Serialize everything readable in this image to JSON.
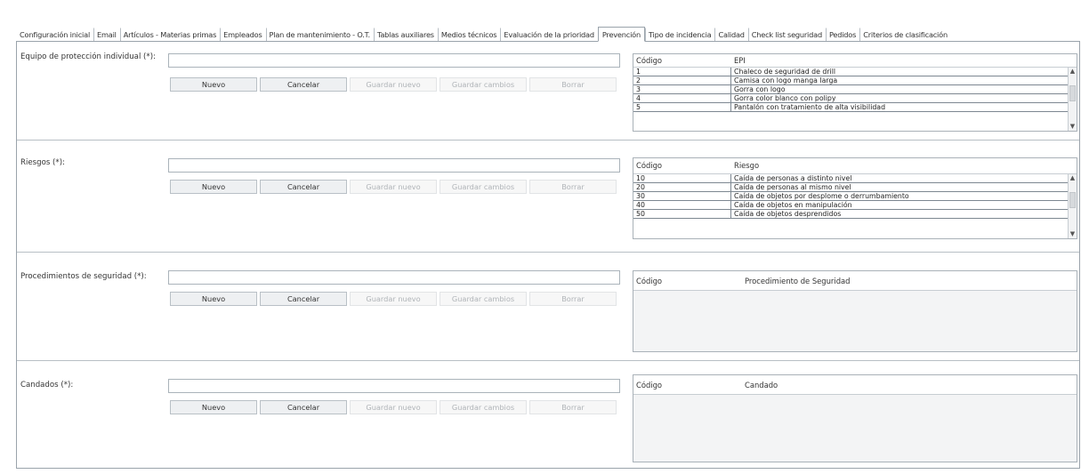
{
  "tabs": [
    {
      "label": "Configuración inicial"
    },
    {
      "label": "Email"
    },
    {
      "label": "Artículos - Materias primas"
    },
    {
      "label": "Empleados"
    },
    {
      "label": "Plan de mantenimiento - O.T."
    },
    {
      "label": "Tablas auxiliares"
    },
    {
      "label": "Medios técnicos"
    },
    {
      "label": "Evaluación de la prioridad"
    },
    {
      "label": "Prevención"
    },
    {
      "label": "Tipo de incidencia"
    },
    {
      "label": "Calidad"
    },
    {
      "label": "Check list seguridad"
    },
    {
      "label": "Pedidos"
    },
    {
      "label": "Criterios de clasificación"
    }
  ],
  "active_tab": "Prevención",
  "buttons": {
    "nuevo": "Nuevo",
    "cancelar": "Cancelar",
    "guardar_nuevo": "Guardar nuevo",
    "guardar_cambios": "Guardar cambios",
    "borrar": "Borrar"
  },
  "sections": {
    "epi": {
      "label": "Equipo de protección individual (*):",
      "input_value": "",
      "col1": "Código",
      "col2": "EPI",
      "rows": [
        {
          "code": "1",
          "name": "Chaleco de seguridad de drill"
        },
        {
          "code": "2",
          "name": "Camisa con logo manga larga"
        },
        {
          "code": "3",
          "name": "Gorra con logo"
        },
        {
          "code": "4",
          "name": "Gorra color blanco con polipy"
        },
        {
          "code": "5",
          "name": "Pantalón con tratamiento de alta visibilidad"
        }
      ]
    },
    "riesgos": {
      "label": "Riesgos (*):",
      "input_value": "",
      "col1": "Código",
      "col2": "Riesgo",
      "rows": [
        {
          "code": "10",
          "name": "Caída de personas a distinto nivel"
        },
        {
          "code": "20",
          "name": "Caída de personas al mismo nivel"
        },
        {
          "code": "30",
          "name": "Caída de objetos por desplome o derrumbamiento"
        },
        {
          "code": "40",
          "name": "Caída de objetos en manipulación"
        },
        {
          "code": "50",
          "name": "Caída de objetos desprendidos"
        }
      ]
    },
    "procedimientos": {
      "label": "Procedimientos de seguridad (*):",
      "input_value": "",
      "col1": "Código",
      "col2": "Procedimiento de Seguridad"
    },
    "candados": {
      "label": "Candados (*):",
      "input_value": "",
      "col1": "Código",
      "col2": "Candado"
    }
  }
}
